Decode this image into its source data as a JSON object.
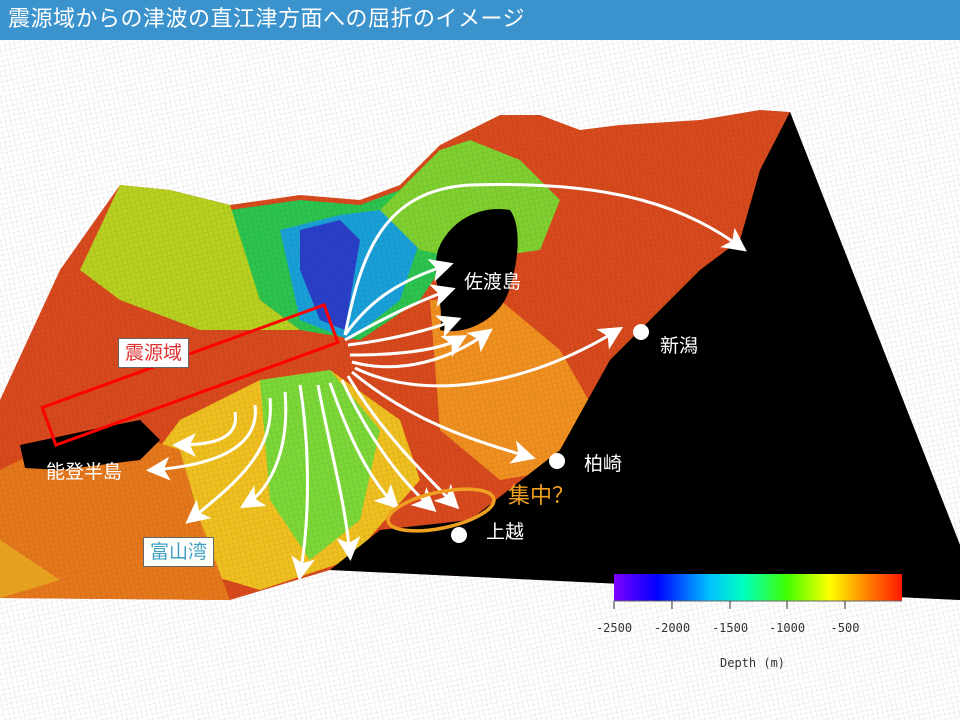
{
  "header": {
    "title": "震源域からの津波の直江津方面への屈折のイメージ"
  },
  "labels": {
    "source_region": "震源域",
    "noto": "能登半島",
    "toyama": "富山湾",
    "sado": "佐渡島",
    "niigata": "新潟",
    "kashiwazaki": "柏崎",
    "joetsu": "上越",
    "concentration": "集中？"
  },
  "colorbar": {
    "title": "Depth (m)",
    "ticks": [
      "-2500",
      "-2000",
      "-1500",
      "-1000",
      "-500"
    ],
    "colors": [
      "#8000ff",
      "#0000ff",
      "#00c0ff",
      "#00ffc0",
      "#40ff00",
      "#ffff00",
      "#ff8000",
      "#ff2000"
    ]
  },
  "colors": {
    "title_bg": "#3b93cd",
    "source_box": "#ff0000",
    "concentration": "#f0a020",
    "toyama_label": "#40a0c0",
    "arrows": "#ffffff"
  }
}
